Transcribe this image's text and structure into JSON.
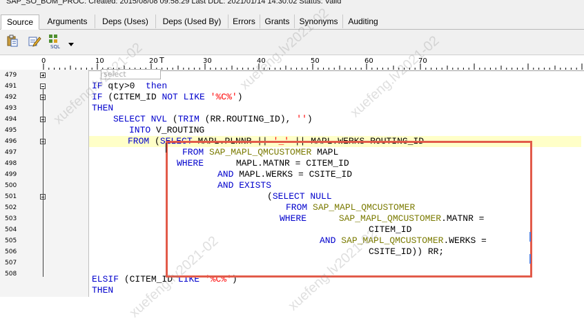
{
  "status": {
    "text": "SAP_SO_BOM_PROC:  Created: 2015/08/08 09:58:29  Last DDL: 2021/01/14 14:30:02  Status:  Valid"
  },
  "tabs": [
    {
      "label": "Source",
      "active": true
    },
    {
      "label": "Arguments",
      "active": false
    },
    {
      "label": "Deps (Uses)",
      "active": false
    },
    {
      "label": "Deps (Used By)",
      "active": false
    },
    {
      "label": "Errors",
      "active": false
    },
    {
      "label": "Grants",
      "active": false
    },
    {
      "label": "Synonyms",
      "active": false
    },
    {
      "label": "Auditing",
      "active": false
    }
  ],
  "toolbar": {
    "buttons": [
      {
        "icon": "paste-icon"
      },
      {
        "icon": "edit-icon"
      },
      {
        "icon": "sql-format-icon"
      },
      {
        "icon": "chevron-down-icon"
      }
    ]
  },
  "ruler": {
    "marks": [
      "0",
      "10",
      "20",
      "30",
      "40",
      "50",
      "60",
      "70"
    ]
  },
  "autocomplete": {
    "placeholder": "select"
  },
  "watermark": {
    "text": "xuefeng.lv2021-02"
  },
  "code": {
    "lines": [
      {
        "num": "479",
        "fold": "plus"
      },
      {
        "num": "491",
        "fold": "minus"
      },
      {
        "num": "492",
        "fold": "minus"
      },
      {
        "num": "493",
        "fold": ""
      },
      {
        "num": "494",
        "fold": "minus"
      },
      {
        "num": "495",
        "fold": ""
      },
      {
        "num": "496",
        "fold": "minus"
      },
      {
        "num": "497",
        "fold": ""
      },
      {
        "num": "498",
        "fold": ""
      },
      {
        "num": "499",
        "fold": ""
      },
      {
        "num": "500",
        "fold": ""
      },
      {
        "num": "501",
        "fold": "minus"
      },
      {
        "num": "502",
        "fold": ""
      },
      {
        "num": "503",
        "fold": ""
      },
      {
        "num": "504",
        "fold": ""
      },
      {
        "num": "505",
        "fold": ""
      },
      {
        "num": "506",
        "fold": ""
      },
      {
        "num": "507",
        "fold": ""
      },
      {
        "num": "508",
        "fold": ""
      }
    ],
    "tokens": {
      "l491a": "IF",
      "l491b": " qty>0  ",
      "l491c": "then",
      "l492a": "IF",
      "l492b": " (CITEM_ID ",
      "l492c": "NOT LIKE",
      "l492d": " ",
      "l492e": "'%C%'",
      "l492f": ")",
      "l493a": "THEN",
      "l494a": "SELECT NVL",
      "l494b": " (",
      "l494c": "TRIM",
      "l494d": " (RR.ROUTING_ID), ",
      "l494e": "''",
      "l494f": ")",
      "l495a": "INTO",
      "l495b": " V_ROUTING",
      "l496a": "FROM",
      "l496b": " (",
      "l496c": "SELECT",
      "l496d": " MAPL.PLNNR || ",
      "l496e": "'_'",
      "l496f": " || MAPL.WERKS ROUTING_ID",
      "l497a": "FROM",
      "l497b": " ",
      "l497c": "SAP_MAPL_QMCUSTOMER",
      "l497d": " MAPL",
      "l498a": "WHERE",
      "l498b": "      MAPL.MATNR = CITEM_ID",
      "l499a": "AND",
      "l499b": " MAPL.WERKS = CSITE_ID",
      "l500a": "AND EXISTS",
      "l501a": "(",
      "l501b": "SELECT NULL",
      "l502a": "FROM",
      "l502b": " ",
      "l502c": "SAP_MAPL_QMCUSTOMER",
      "l503a": "WHERE",
      "l503b": "      ",
      "l503c": "SAP_MAPL_QMCUSTOMER",
      "l503d": ".MATNR =",
      "l504a": "CITEM_ID",
      "l505a": "AND",
      "l505b": " ",
      "l505c": "SAP_MAPL_QMCUSTOMER",
      "l505d": ".WERKS =",
      "l506a": "CSITE_ID)",
      ") ": "",
      "l506b": ") RR;",
      "l507a": "ELSIF",
      "l507b": " (CITEM_ID ",
      "l507c": "LIKE",
      "l507d": " ",
      "l507e": "'%C%'",
      "l507f": ")",
      "l508a": "THEN"
    }
  }
}
